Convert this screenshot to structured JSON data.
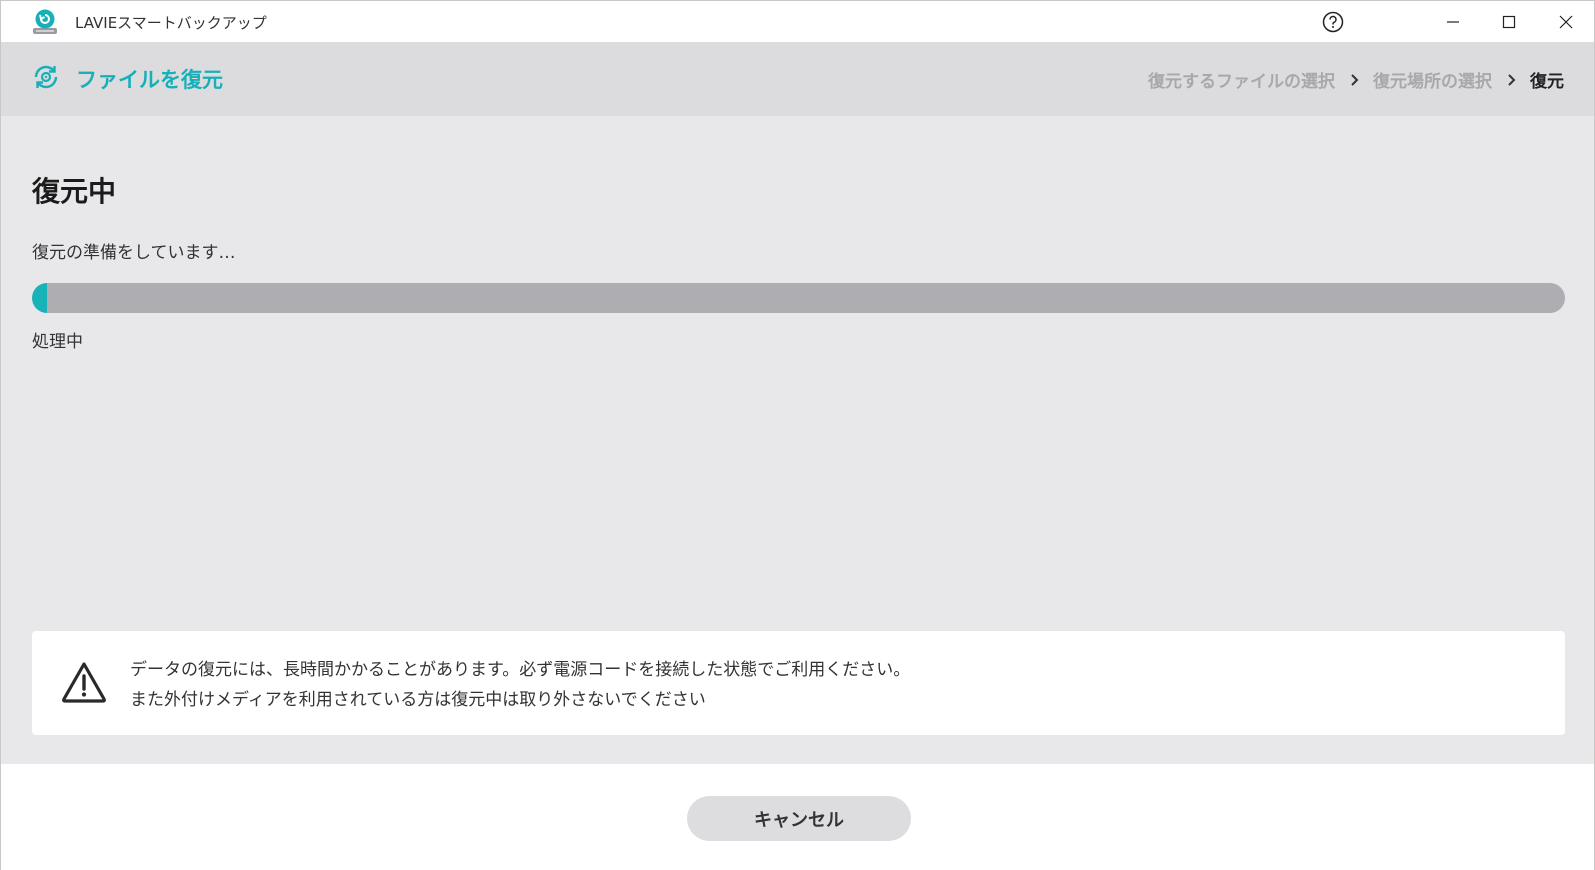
{
  "window": {
    "title": "LAVIEスマートバックアップ",
    "controls": {
      "help_icon": "question-circle-icon",
      "minimize_icon": "minimize-icon",
      "maximize_icon": "maximize-icon",
      "close_icon": "close-icon"
    }
  },
  "header": {
    "title": "ファイルを復元",
    "icon": "restore-gear-icon",
    "accent_color": "#17b0b8",
    "breadcrumb": [
      {
        "label": "復元するファイルの選択",
        "active": false
      },
      {
        "label": "復元場所の選択",
        "active": false
      },
      {
        "label": "復元",
        "active": true
      }
    ]
  },
  "main": {
    "title": "復元中",
    "status": "復元の準備をしています…",
    "progress": {
      "value_percent": 1,
      "label": "処理中",
      "fill_color": "#16b3b8",
      "track_color": "#aeaeb2"
    },
    "notice": {
      "icon": "warning-triangle-icon",
      "line1": "データの復元には、長時間かかることがあります。必ず電源コードを接続した状態でご利用ください。",
      "line2": "また外付けメディアを利用されている方は復元中は取り外さないでください"
    }
  },
  "footer": {
    "cancel_label": "キャンセル"
  }
}
